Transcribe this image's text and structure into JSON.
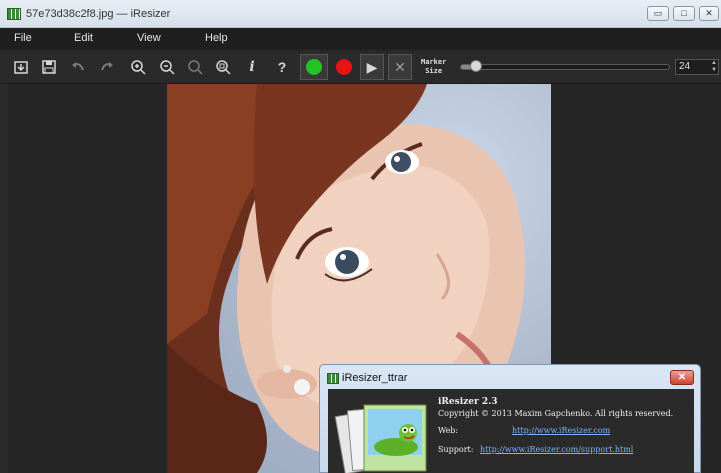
{
  "window": {
    "title": "57e73d38c2f8.jpg — iResizer",
    "minimize": "▭",
    "maximize": "□",
    "close": "✕"
  },
  "menu": [
    "File",
    "Edit",
    "View",
    "Help"
  ],
  "toolbar": {
    "icons": [
      "open-icon",
      "save-icon",
      "undo-icon",
      "redo-icon",
      "zoom-in-icon",
      "zoom-out-icon",
      "zoom-actual-icon",
      "zoom-fit-icon",
      "info-icon",
      "help-icon",
      "green-marker-icon",
      "red-marker-icon",
      "play-icon",
      "clear-icon"
    ],
    "glyphs": {
      "info": "i",
      "help": "?",
      "play": "▶",
      "clear": "✕"
    },
    "marker_size_label_line1": "Marker",
    "marker_size_label_line2": "Size",
    "marker_size_value": "24",
    "marker_size_fraction": 0.07,
    "colors": {
      "green": "#22c322",
      "red": "#e81414"
    }
  },
  "about_dialog": {
    "title": "iResizer_ttrar",
    "close": "✕",
    "app_name": "iResizer 2.3",
    "copyright": "Copyright © 2013 Maxim Gapchenko. All rights reserved.",
    "web_label": "Web:",
    "web_url": "http://www.iResizer.com",
    "support_label": "Support:",
    "support_url": "http://www.iResizer.com/support.html"
  }
}
